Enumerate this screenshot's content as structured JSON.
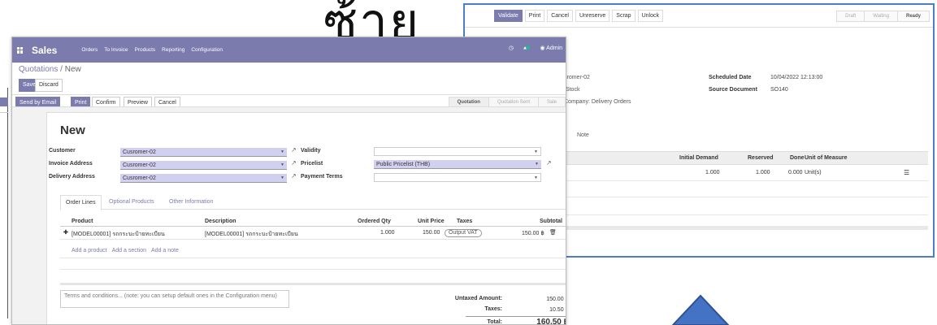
{
  "overlay_title": "ซ้าย",
  "transfer": {
    "buttons": [
      "Validate",
      "Print",
      "Cancel",
      "Unreserve",
      "Scrap",
      "Unlock"
    ],
    "stages": [
      "Draft",
      "Waiting",
      "Ready"
    ],
    "partner": "sromer-02",
    "location": "/Stock",
    "operation_type": "Company: Delivery Orders",
    "scheduled_label": "Scheduled Date",
    "scheduled_value": "10/04/2022 12:13:00",
    "source_label": "Source Document",
    "source_value": "SO140",
    "tabs": [
      "s",
      "Note"
    ],
    "columns": [
      "Initial Demand",
      "Reserved",
      "Done",
      "Unit of Measure"
    ],
    "row": {
      "initial": "1.000",
      "reserved": "1.000",
      "done": "0.000",
      "uom": "Unit(s)"
    }
  },
  "sales": {
    "app_name": "Sales",
    "menu": [
      "Orders",
      "To Invoice",
      "Products",
      "Reporting",
      "Configuration"
    ],
    "user": "Admin",
    "breadcrumb_parent": "Quotations",
    "breadcrumb_sep": "/",
    "breadcrumb_current": "New",
    "save": "Save",
    "discard": "Discard",
    "actions": [
      "Send by Email",
      "Print",
      "Confirm",
      "Preview",
      "Cancel"
    ],
    "stages": [
      "Quotation",
      "Quotation Sent",
      "Sale"
    ],
    "title": "New",
    "fields": {
      "customer_label": "Customer",
      "customer_value": "Cusromer-02",
      "invoice_label": "Invoice Address",
      "invoice_value": "Cusromer-02",
      "delivery_label": "Delivery Address",
      "delivery_value": "Cusromer-02",
      "validity_label": "Validity",
      "validity_value": "",
      "pricelist_label": "Pricelist",
      "pricelist_value": "Public Pricelist (THB)",
      "payment_label": "Payment Terms",
      "payment_value": ""
    },
    "tabs": [
      "Order Lines",
      "Optional Products",
      "Other Information"
    ],
    "columns": [
      "Product",
      "Description",
      "Ordered Qty",
      "Unit Price",
      "Taxes",
      "Subtotal"
    ],
    "line": {
      "product": "[MODEL00001] รถกระบะป้ายทะเบียน",
      "description": "[MODEL00001] รถกระบะป้ายทะเบียน",
      "qty": "1.000",
      "price": "150.00",
      "tax": "Output VAT",
      "subtotal": "150.00 ฿"
    },
    "add_links": [
      "Add a product",
      "Add a section",
      "Add a note"
    ],
    "terms_placeholder": "Terms and conditions... (note: you can setup default ones in the Configuration menu)",
    "totals": {
      "untaxed_label": "Untaxed Amount:",
      "untaxed_value": "150.00 ฿",
      "taxes_label": "Taxes:",
      "taxes_value": "10.50 ฿",
      "total_label": "Total:",
      "total_value": "160.50 ฿"
    }
  },
  "colors": {
    "brand": "#7c7bad",
    "accent_blue": "#4a7ec9",
    "arrow": "#4472c4"
  }
}
